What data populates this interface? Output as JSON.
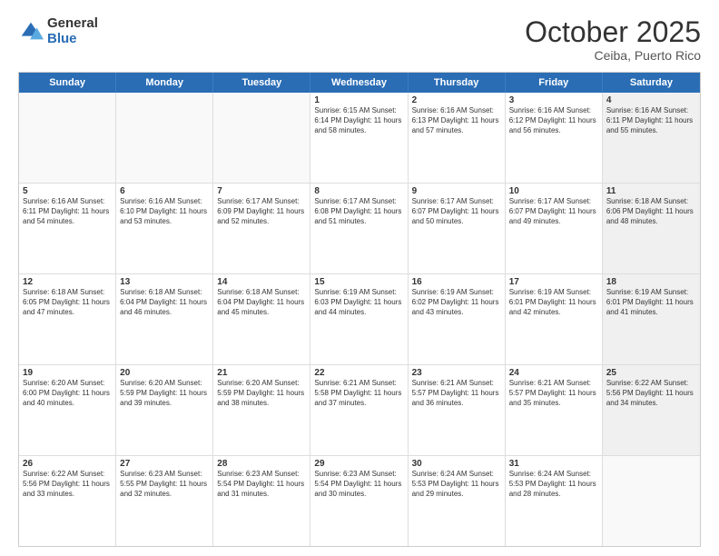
{
  "header": {
    "logo_general": "General",
    "logo_blue": "Blue",
    "month": "October 2025",
    "location": "Ceiba, Puerto Rico"
  },
  "weekdays": [
    "Sunday",
    "Monday",
    "Tuesday",
    "Wednesday",
    "Thursday",
    "Friday",
    "Saturday"
  ],
  "rows": [
    [
      {
        "day": "",
        "text": "",
        "empty": true
      },
      {
        "day": "",
        "text": "",
        "empty": true
      },
      {
        "day": "",
        "text": "",
        "empty": true
      },
      {
        "day": "1",
        "text": "Sunrise: 6:15 AM\nSunset: 6:14 PM\nDaylight: 11 hours\nand 58 minutes.",
        "empty": false
      },
      {
        "day": "2",
        "text": "Sunrise: 6:16 AM\nSunset: 6:13 PM\nDaylight: 11 hours\nand 57 minutes.",
        "empty": false
      },
      {
        "day": "3",
        "text": "Sunrise: 6:16 AM\nSunset: 6:12 PM\nDaylight: 11 hours\nand 56 minutes.",
        "empty": false
      },
      {
        "day": "4",
        "text": "Sunrise: 6:16 AM\nSunset: 6:11 PM\nDaylight: 11 hours\nand 55 minutes.",
        "empty": false,
        "shaded": true
      }
    ],
    [
      {
        "day": "5",
        "text": "Sunrise: 6:16 AM\nSunset: 6:11 PM\nDaylight: 11 hours\nand 54 minutes.",
        "empty": false
      },
      {
        "day": "6",
        "text": "Sunrise: 6:16 AM\nSunset: 6:10 PM\nDaylight: 11 hours\nand 53 minutes.",
        "empty": false
      },
      {
        "day": "7",
        "text": "Sunrise: 6:17 AM\nSunset: 6:09 PM\nDaylight: 11 hours\nand 52 minutes.",
        "empty": false
      },
      {
        "day": "8",
        "text": "Sunrise: 6:17 AM\nSunset: 6:08 PM\nDaylight: 11 hours\nand 51 minutes.",
        "empty": false
      },
      {
        "day": "9",
        "text": "Sunrise: 6:17 AM\nSunset: 6:07 PM\nDaylight: 11 hours\nand 50 minutes.",
        "empty": false
      },
      {
        "day": "10",
        "text": "Sunrise: 6:17 AM\nSunset: 6:07 PM\nDaylight: 11 hours\nand 49 minutes.",
        "empty": false
      },
      {
        "day": "11",
        "text": "Sunrise: 6:18 AM\nSunset: 6:06 PM\nDaylight: 11 hours\nand 48 minutes.",
        "empty": false,
        "shaded": true
      }
    ],
    [
      {
        "day": "12",
        "text": "Sunrise: 6:18 AM\nSunset: 6:05 PM\nDaylight: 11 hours\nand 47 minutes.",
        "empty": false
      },
      {
        "day": "13",
        "text": "Sunrise: 6:18 AM\nSunset: 6:04 PM\nDaylight: 11 hours\nand 46 minutes.",
        "empty": false
      },
      {
        "day": "14",
        "text": "Sunrise: 6:18 AM\nSunset: 6:04 PM\nDaylight: 11 hours\nand 45 minutes.",
        "empty": false
      },
      {
        "day": "15",
        "text": "Sunrise: 6:19 AM\nSunset: 6:03 PM\nDaylight: 11 hours\nand 44 minutes.",
        "empty": false
      },
      {
        "day": "16",
        "text": "Sunrise: 6:19 AM\nSunset: 6:02 PM\nDaylight: 11 hours\nand 43 minutes.",
        "empty": false
      },
      {
        "day": "17",
        "text": "Sunrise: 6:19 AM\nSunset: 6:01 PM\nDaylight: 11 hours\nand 42 minutes.",
        "empty": false
      },
      {
        "day": "18",
        "text": "Sunrise: 6:19 AM\nSunset: 6:01 PM\nDaylight: 11 hours\nand 41 minutes.",
        "empty": false,
        "shaded": true
      }
    ],
    [
      {
        "day": "19",
        "text": "Sunrise: 6:20 AM\nSunset: 6:00 PM\nDaylight: 11 hours\nand 40 minutes.",
        "empty": false
      },
      {
        "day": "20",
        "text": "Sunrise: 6:20 AM\nSunset: 5:59 PM\nDaylight: 11 hours\nand 39 minutes.",
        "empty": false
      },
      {
        "day": "21",
        "text": "Sunrise: 6:20 AM\nSunset: 5:59 PM\nDaylight: 11 hours\nand 38 minutes.",
        "empty": false
      },
      {
        "day": "22",
        "text": "Sunrise: 6:21 AM\nSunset: 5:58 PM\nDaylight: 11 hours\nand 37 minutes.",
        "empty": false
      },
      {
        "day": "23",
        "text": "Sunrise: 6:21 AM\nSunset: 5:57 PM\nDaylight: 11 hours\nand 36 minutes.",
        "empty": false
      },
      {
        "day": "24",
        "text": "Sunrise: 6:21 AM\nSunset: 5:57 PM\nDaylight: 11 hours\nand 35 minutes.",
        "empty": false
      },
      {
        "day": "25",
        "text": "Sunrise: 6:22 AM\nSunset: 5:56 PM\nDaylight: 11 hours\nand 34 minutes.",
        "empty": false,
        "shaded": true
      }
    ],
    [
      {
        "day": "26",
        "text": "Sunrise: 6:22 AM\nSunset: 5:56 PM\nDaylight: 11 hours\nand 33 minutes.",
        "empty": false
      },
      {
        "day": "27",
        "text": "Sunrise: 6:23 AM\nSunset: 5:55 PM\nDaylight: 11 hours\nand 32 minutes.",
        "empty": false
      },
      {
        "day": "28",
        "text": "Sunrise: 6:23 AM\nSunset: 5:54 PM\nDaylight: 11 hours\nand 31 minutes.",
        "empty": false
      },
      {
        "day": "29",
        "text": "Sunrise: 6:23 AM\nSunset: 5:54 PM\nDaylight: 11 hours\nand 30 minutes.",
        "empty": false
      },
      {
        "day": "30",
        "text": "Sunrise: 6:24 AM\nSunset: 5:53 PM\nDaylight: 11 hours\nand 29 minutes.",
        "empty": false
      },
      {
        "day": "31",
        "text": "Sunrise: 6:24 AM\nSunset: 5:53 PM\nDaylight: 11 hours\nand 28 minutes.",
        "empty": false
      },
      {
        "day": "",
        "text": "",
        "empty": true
      }
    ]
  ]
}
